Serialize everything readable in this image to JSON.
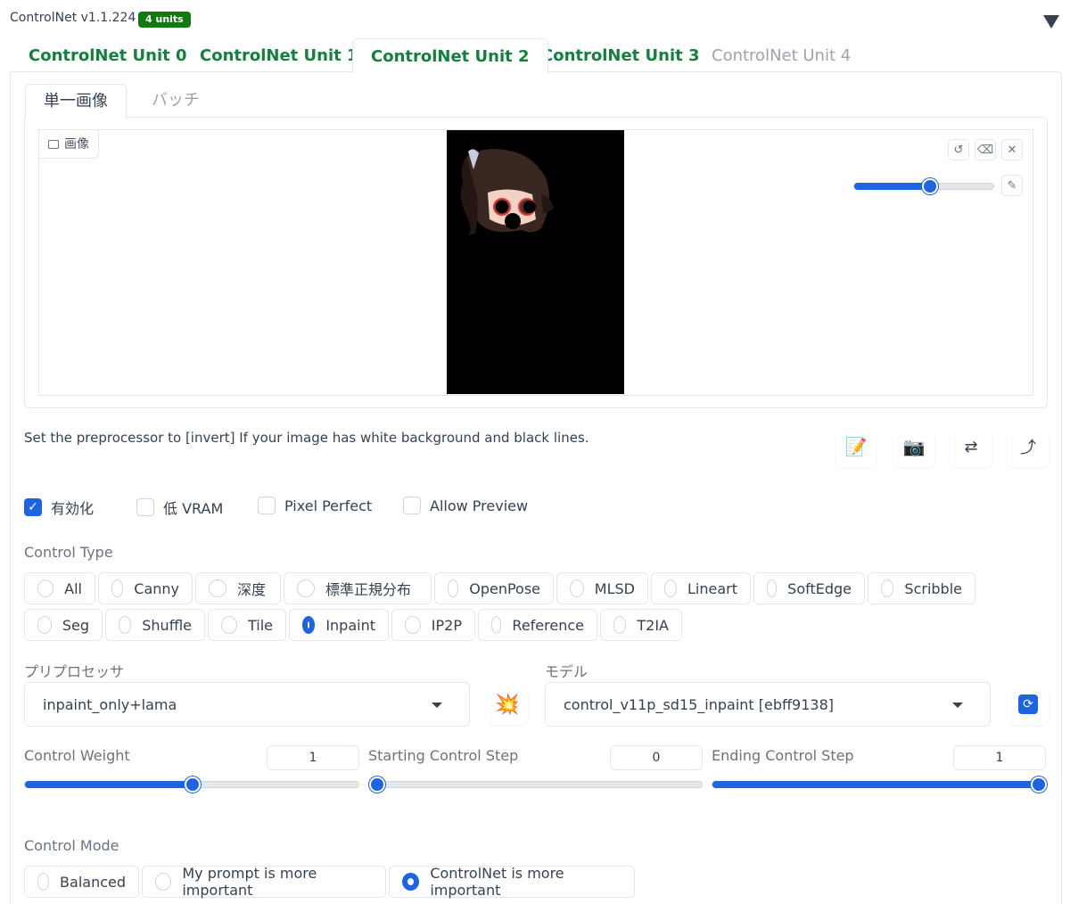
{
  "header": {
    "title": "ControlNet v1.1.224",
    "badge": "4 units"
  },
  "unit_tabs": [
    "ControlNet Unit 0",
    "ControlNet Unit 1",
    "ControlNet Unit 2",
    "ControlNet Unit 3",
    "ControlNet Unit 4"
  ],
  "active_unit_tab": "ControlNet Unit 2",
  "inner_tabs": [
    "単一画像",
    "バッチ"
  ],
  "image": {
    "label": "画像",
    "brush_size_fraction": 0.55
  },
  "hint": "Set the preprocessor to [invert] If your image has white background and black lines.",
  "options": [
    {
      "label": "有効化",
      "checked": true
    },
    {
      "label": "低 VRAM",
      "checked": false
    },
    {
      "label": "Pixel Perfect",
      "checked": false
    },
    {
      "label": "Allow Preview",
      "checked": false
    }
  ],
  "control_type": {
    "label": "Control Type",
    "items": [
      "All",
      "Canny",
      "深度",
      "標準正規分布",
      "OpenPose",
      "MLSD",
      "Lineart",
      "SoftEdge",
      "Scribble",
      "Seg",
      "Shuffle",
      "Tile",
      "Inpaint",
      "IP2P",
      "Reference",
      "T2IA"
    ],
    "selected": "Inpaint"
  },
  "preprocessor": {
    "label": "プリプロセッサ",
    "value": "inpaint_only+lama"
  },
  "model": {
    "label": "モデル",
    "value": "control_v11p_sd15_inpaint [ebff9138]"
  },
  "sliders": {
    "weight": {
      "label": "Control Weight",
      "value": "1",
      "min": 0,
      "max": 2,
      "fraction": 0.5
    },
    "start": {
      "label": "Starting Control Step",
      "value": "0",
      "min": 0,
      "max": 1,
      "fraction": 0.0
    },
    "end": {
      "label": "Ending Control Step",
      "value": "1",
      "min": 0,
      "max": 1,
      "fraction": 1.0
    }
  },
  "control_mode": {
    "label": "Control Mode",
    "items": [
      "Balanced",
      "My prompt is more important",
      "ControlNet is more important"
    ],
    "selected": "ControlNet is more important"
  },
  "colors": {
    "accent": "#1e63e0",
    "tab_green": "#15803d",
    "badge": "#0f7b0f"
  }
}
